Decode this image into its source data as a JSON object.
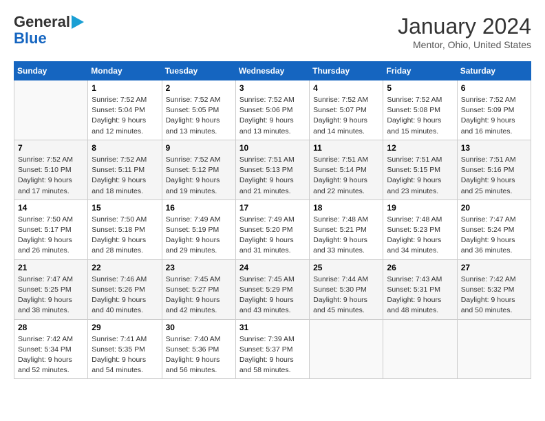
{
  "header": {
    "logo_line1": "General",
    "logo_line2": "Blue",
    "title": "January 2024",
    "location": "Mentor, Ohio, United States"
  },
  "calendar": {
    "days_of_week": [
      "Sunday",
      "Monday",
      "Tuesday",
      "Wednesday",
      "Thursday",
      "Friday",
      "Saturday"
    ],
    "weeks": [
      [
        {
          "day": "",
          "info": ""
        },
        {
          "day": "1",
          "info": "Sunrise: 7:52 AM\nSunset: 5:04 PM\nDaylight: 9 hours\nand 12 minutes."
        },
        {
          "day": "2",
          "info": "Sunrise: 7:52 AM\nSunset: 5:05 PM\nDaylight: 9 hours\nand 13 minutes."
        },
        {
          "day": "3",
          "info": "Sunrise: 7:52 AM\nSunset: 5:06 PM\nDaylight: 9 hours\nand 13 minutes."
        },
        {
          "day": "4",
          "info": "Sunrise: 7:52 AM\nSunset: 5:07 PM\nDaylight: 9 hours\nand 14 minutes."
        },
        {
          "day": "5",
          "info": "Sunrise: 7:52 AM\nSunset: 5:08 PM\nDaylight: 9 hours\nand 15 minutes."
        },
        {
          "day": "6",
          "info": "Sunrise: 7:52 AM\nSunset: 5:09 PM\nDaylight: 9 hours\nand 16 minutes."
        }
      ],
      [
        {
          "day": "7",
          "info": "Sunrise: 7:52 AM\nSunset: 5:10 PM\nDaylight: 9 hours\nand 17 minutes."
        },
        {
          "day": "8",
          "info": "Sunrise: 7:52 AM\nSunset: 5:11 PM\nDaylight: 9 hours\nand 18 minutes."
        },
        {
          "day": "9",
          "info": "Sunrise: 7:52 AM\nSunset: 5:12 PM\nDaylight: 9 hours\nand 19 minutes."
        },
        {
          "day": "10",
          "info": "Sunrise: 7:51 AM\nSunset: 5:13 PM\nDaylight: 9 hours\nand 21 minutes."
        },
        {
          "day": "11",
          "info": "Sunrise: 7:51 AM\nSunset: 5:14 PM\nDaylight: 9 hours\nand 22 minutes."
        },
        {
          "day": "12",
          "info": "Sunrise: 7:51 AM\nSunset: 5:15 PM\nDaylight: 9 hours\nand 23 minutes."
        },
        {
          "day": "13",
          "info": "Sunrise: 7:51 AM\nSunset: 5:16 PM\nDaylight: 9 hours\nand 25 minutes."
        }
      ],
      [
        {
          "day": "14",
          "info": "Sunrise: 7:50 AM\nSunset: 5:17 PM\nDaylight: 9 hours\nand 26 minutes."
        },
        {
          "day": "15",
          "info": "Sunrise: 7:50 AM\nSunset: 5:18 PM\nDaylight: 9 hours\nand 28 minutes."
        },
        {
          "day": "16",
          "info": "Sunrise: 7:49 AM\nSunset: 5:19 PM\nDaylight: 9 hours\nand 29 minutes."
        },
        {
          "day": "17",
          "info": "Sunrise: 7:49 AM\nSunset: 5:20 PM\nDaylight: 9 hours\nand 31 minutes."
        },
        {
          "day": "18",
          "info": "Sunrise: 7:48 AM\nSunset: 5:21 PM\nDaylight: 9 hours\nand 33 minutes."
        },
        {
          "day": "19",
          "info": "Sunrise: 7:48 AM\nSunset: 5:23 PM\nDaylight: 9 hours\nand 34 minutes."
        },
        {
          "day": "20",
          "info": "Sunrise: 7:47 AM\nSunset: 5:24 PM\nDaylight: 9 hours\nand 36 minutes."
        }
      ],
      [
        {
          "day": "21",
          "info": "Sunrise: 7:47 AM\nSunset: 5:25 PM\nDaylight: 9 hours\nand 38 minutes."
        },
        {
          "day": "22",
          "info": "Sunrise: 7:46 AM\nSunset: 5:26 PM\nDaylight: 9 hours\nand 40 minutes."
        },
        {
          "day": "23",
          "info": "Sunrise: 7:45 AM\nSunset: 5:27 PM\nDaylight: 9 hours\nand 42 minutes."
        },
        {
          "day": "24",
          "info": "Sunrise: 7:45 AM\nSunset: 5:29 PM\nDaylight: 9 hours\nand 43 minutes."
        },
        {
          "day": "25",
          "info": "Sunrise: 7:44 AM\nSunset: 5:30 PM\nDaylight: 9 hours\nand 45 minutes."
        },
        {
          "day": "26",
          "info": "Sunrise: 7:43 AM\nSunset: 5:31 PM\nDaylight: 9 hours\nand 48 minutes."
        },
        {
          "day": "27",
          "info": "Sunrise: 7:42 AM\nSunset: 5:32 PM\nDaylight: 9 hours\nand 50 minutes."
        }
      ],
      [
        {
          "day": "28",
          "info": "Sunrise: 7:42 AM\nSunset: 5:34 PM\nDaylight: 9 hours\nand 52 minutes."
        },
        {
          "day": "29",
          "info": "Sunrise: 7:41 AM\nSunset: 5:35 PM\nDaylight: 9 hours\nand 54 minutes."
        },
        {
          "day": "30",
          "info": "Sunrise: 7:40 AM\nSunset: 5:36 PM\nDaylight: 9 hours\nand 56 minutes."
        },
        {
          "day": "31",
          "info": "Sunrise: 7:39 AM\nSunset: 5:37 PM\nDaylight: 9 hours\nand 58 minutes."
        },
        {
          "day": "",
          "info": ""
        },
        {
          "day": "",
          "info": ""
        },
        {
          "day": "",
          "info": ""
        }
      ]
    ]
  }
}
